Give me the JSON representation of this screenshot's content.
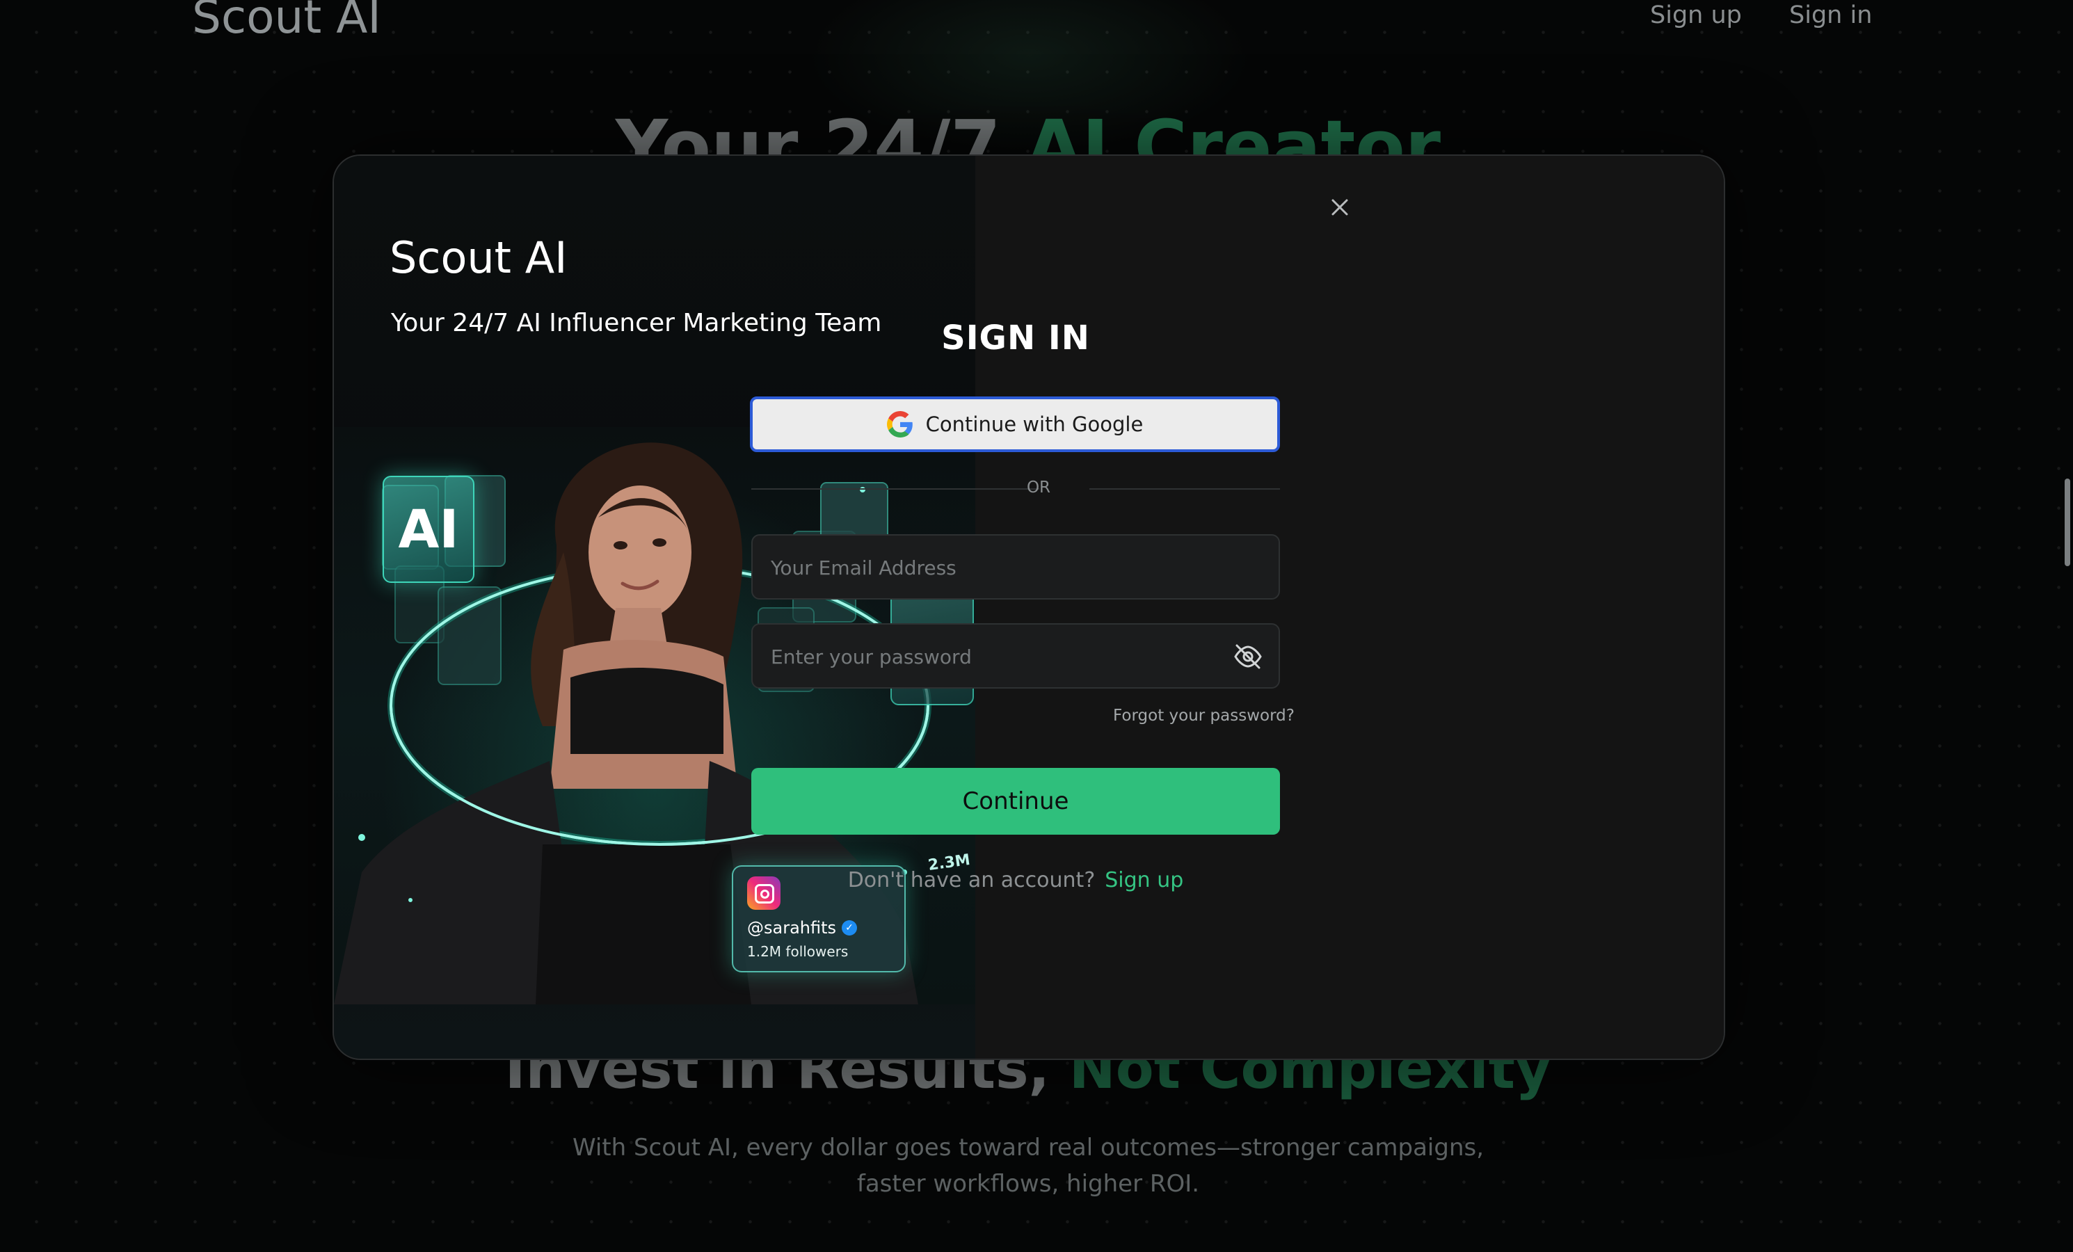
{
  "background": {
    "nav": {
      "logo": "Scout AI",
      "signup_label": "Sign up",
      "signin_label": "Sign in"
    },
    "hero": {
      "title_plain": "Your 24/7 ",
      "title_accent": "AI Creator"
    },
    "section": {
      "title_plain": "Invest in Results, ",
      "title_accent": "Not Complexity",
      "subtitle": "With Scout AI, every dollar goes toward real outcomes—stronger campaigns, faster workflows, higher ROI."
    }
  },
  "modal": {
    "brand": {
      "logo": "Scout AI",
      "tagline": "Your 24/7 AI Influencer Marketing Team"
    },
    "illustration": {
      "ai_badge": "AI",
      "followers_count_badge": "2.3M",
      "profile_card": {
        "platform_icon": "instagram-icon",
        "handle": "@sarahfits",
        "followers": "1.2M followers"
      }
    },
    "form": {
      "title": "SIGN IN",
      "google_button": "Continue with Google",
      "or_label": "OR",
      "email_placeholder": "Your Email Address",
      "email_value": "",
      "password_placeholder": "Enter your password",
      "password_value": "",
      "forgot_password": "Forgot your password?",
      "continue_button": "Continue",
      "signup_prompt": "Don't have an account?",
      "signup_link": "Sign up"
    },
    "icons": {
      "close": "close-icon",
      "google": "google-icon",
      "password_toggle": "eye-off-icon"
    }
  },
  "colors": {
    "accent_green": "#2fbf7c",
    "link_green": "#35c483",
    "google_focus_border": "#2d5bd7",
    "teal_glow": "#3ed5b9"
  }
}
